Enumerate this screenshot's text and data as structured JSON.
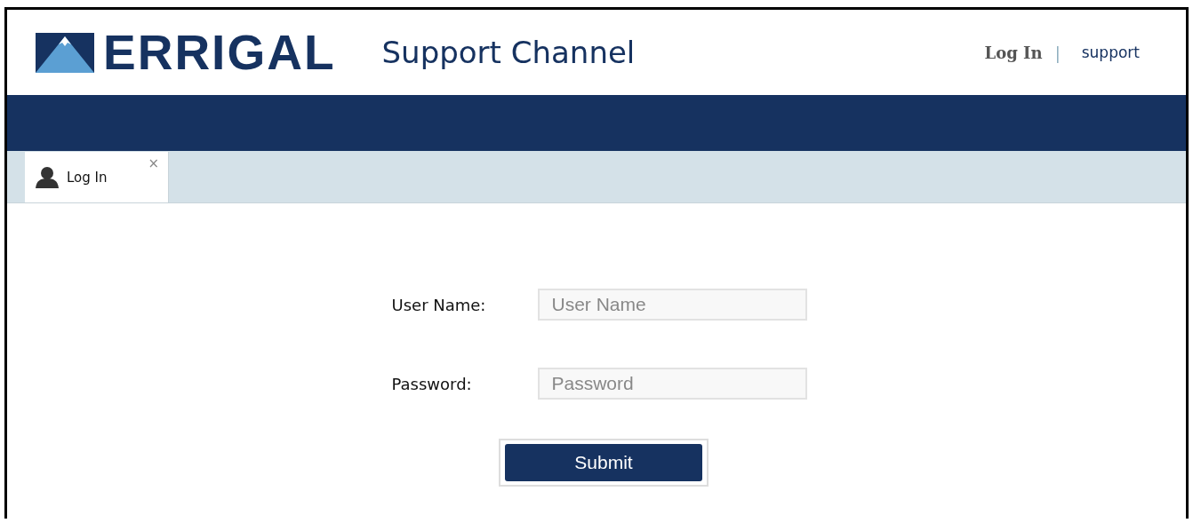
{
  "header": {
    "logo_text": "ERRIGAL",
    "title": "Support Channel",
    "links": [
      {
        "label": "Log In",
        "kind": "bold"
      },
      {
        "label": "|",
        "kind": "separator"
      },
      {
        "label": "support",
        "kind": "plain"
      }
    ]
  },
  "tabs": [
    {
      "label": "Log In",
      "close": "×",
      "selected": true
    }
  ],
  "form": {
    "fields": [
      {
        "label": "User Name:",
        "placeholder": "User Name"
      },
      {
        "label": "Password:",
        "placeholder": "Password"
      }
    ],
    "submit": "Submit"
  }
}
